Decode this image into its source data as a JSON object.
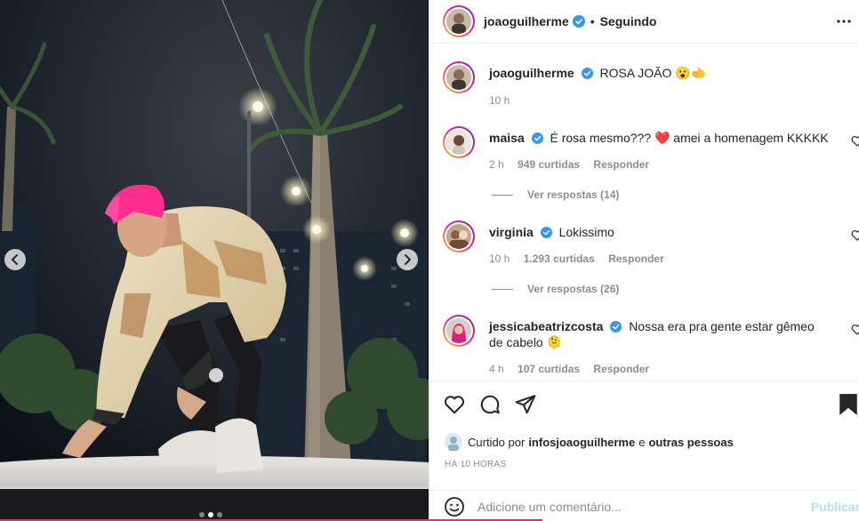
{
  "post": {
    "author": "joaoguilherme",
    "follow_status": "Seguindo",
    "caption": "ROSA JOÃO 😮🫲",
    "caption_time": "10 h",
    "liked_by_prefix": "Curtido por",
    "liked_by_user": "infosjoaoguilherme",
    "liked_by_and": "e",
    "liked_by_others": "outras pessoas",
    "posted_ago": "HÁ 10 HORAS"
  },
  "comments": [
    {
      "user": "maisa",
      "text": "É rosa mesmo??? ❤️ amei a homenagem KKKKK",
      "time": "2 h",
      "likes": "949 curtidas",
      "reply": "Responder",
      "view_replies": "Ver respostas (14)"
    },
    {
      "user": "virginia",
      "text": "Lokissimo",
      "time": "10 h",
      "likes": "1.293 curtidas",
      "reply": "Responder",
      "view_replies": "Ver respostas (26)"
    },
    {
      "user": "jessicabeatrizcosta",
      "text": "Nossa era pra gente estar gêmeo de cabelo 🫠",
      "time": "4 h",
      "likes": "107 curtidas",
      "reply": "Responder"
    }
  ],
  "composer": {
    "placeholder": "Adicione um comentário...",
    "publish_label": "Publicar"
  },
  "icons": {
    "verified": "verified-badge-icon",
    "more": "more-options-icon",
    "like": "heart-icon",
    "comment": "comment-icon",
    "share": "paper-plane-icon",
    "save": "bookmark-icon",
    "emoji": "smiley-icon"
  },
  "colors": {
    "verified": "#3897f0",
    "heart_red": "#ed4956",
    "publish_disabled": "#b2dffc",
    "hair_pink": "#ff2d8f"
  }
}
